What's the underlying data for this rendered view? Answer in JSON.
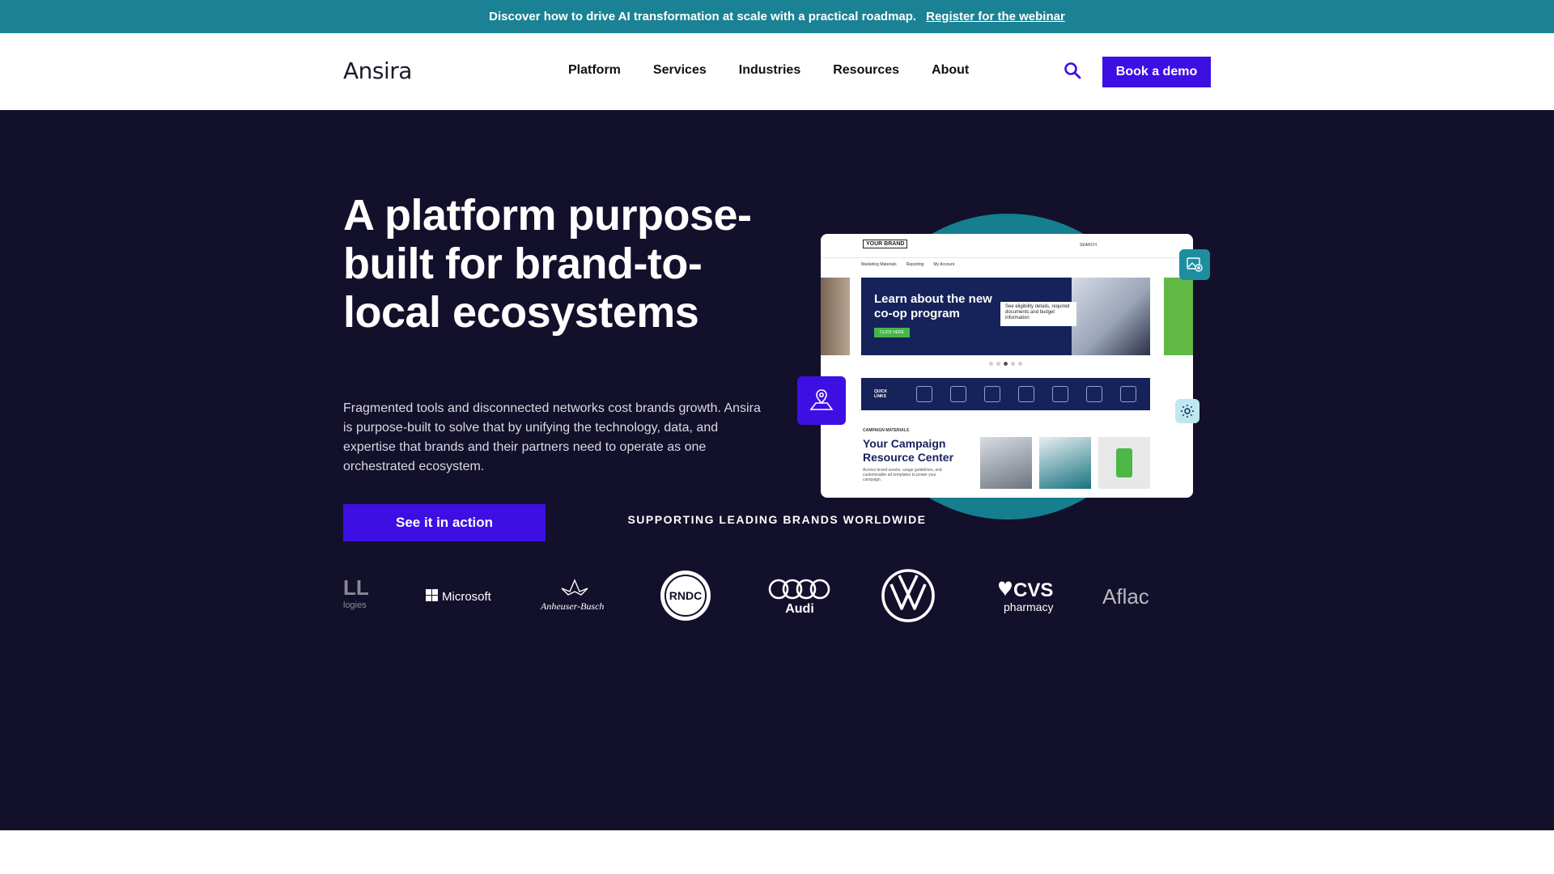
{
  "announcement": {
    "message": "Discover how to drive AI transformation at scale with a practical roadmap.",
    "link": "Register for the webinar"
  },
  "header": {
    "logo": "Ansira",
    "nav": [
      "Platform",
      "Services",
      "Industries",
      "Resources",
      "About"
    ],
    "search_icon": "search-icon",
    "demo_button": "Book a demo"
  },
  "hero": {
    "title": "A platform purpose-built for brand-to-local ecosystems",
    "description": "Fragmented tools and disconnected networks cost brands growth. Ansira is purpose-built to solve that by unifying the technology, data, and expertise that brands and their partners need to operate as one orchestrated ecosystem.",
    "cta": "See it in action"
  },
  "mockup": {
    "brand": "YOUR BRAND",
    "search": "SEARCH",
    "subnav": [
      "Marketing Materials",
      "Reporting",
      "My Account"
    ],
    "banner_title": "Learn about the new co-op program",
    "banner_button": "CLICK HERE",
    "banner_card": "See eligibility details, required documents and budget information",
    "quick_links": "QUICK LINKS",
    "campaign_label": "CAMPAIGN MATERIALS",
    "campaign_title": "Your Campaign Resource Center",
    "campaign_desc": "Access brand assets, usage guidelines, and customizable ad templates to power your campaign."
  },
  "brands": {
    "title": "SUPPORTING LEADING BRANDS WORLDWIDE",
    "logos": [
      "DELL Technologies",
      "Microsoft",
      "Anheuser-Busch",
      "RNDC",
      "Audi",
      "Volkswagen",
      "CVS pharmacy",
      "Aflac"
    ]
  },
  "colors": {
    "accent": "#3d0fe3",
    "teal": "#1a8294",
    "hero_bg": "#12102a"
  }
}
